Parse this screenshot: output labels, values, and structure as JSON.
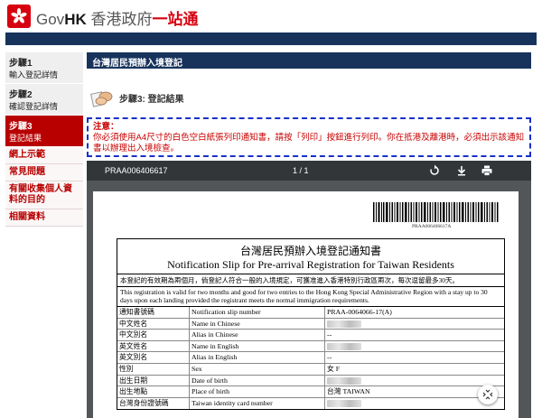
{
  "header": {
    "brand_gov": "Gov",
    "brand_hk": "HK",
    "brand_cn": "香港政府",
    "brand_onestop": "一站通"
  },
  "nav": {
    "steps": [
      {
        "title": "步驟1",
        "subtitle": "輸入登記詳情"
      },
      {
        "title": "步驟2",
        "subtitle": "確認登記詳情"
      },
      {
        "title": "步驟3",
        "subtitle": "登記結果"
      }
    ],
    "links": [
      "網上示範",
      "常見問題",
      "有關收集個人資料的目的",
      "相關資料"
    ]
  },
  "main": {
    "title": "台灣居民預辦入境登記",
    "step_heading": "步驟3: 登記結果"
  },
  "notice": {
    "heading": "注意：",
    "text": "你必須使用A4尺寸的白色空白紙張列印通知書，請按「列印」按鈕進行列印。你在抵港及離港時，必須出示該通知書以辦理出入境檢查。"
  },
  "viewer": {
    "filename": "PRAA006406617",
    "page_indicator": "1 / 1",
    "icons": [
      "rotate-icon",
      "download-icon",
      "print-icon"
    ]
  },
  "slip": {
    "barcode_number": "PRAA006406617A",
    "title_zh": "台灣居民預辦入境登記通知書",
    "title_en": "Notification Slip for Pre-arrival Registration for Taiwan Residents",
    "para_zh": "本登記的有效期為兩個月，倘登記人符合一般的入境規定，可獲准進入香港特別行政區兩次，每次逗留最多30天。",
    "para_en": "This registration is valid for two months and good for two entries to the Hong Kong Special Administrative Region with a stay up to 30 days upon each landing provided the registrant meets the normal immigration requirements.",
    "rows": [
      {
        "zh": "通知書號碼",
        "en": "Notification slip number",
        "value": "PRAA-0064066-17(A)",
        "redacted": false
      },
      {
        "zh": "中文姓名",
        "en": "Name in Chinese",
        "value": "",
        "redacted": true
      },
      {
        "zh": "中文別名",
        "en": "Alias in Chinese",
        "value": "--",
        "redacted": false
      },
      {
        "zh": "英文姓名",
        "en": "Name in English",
        "value": "",
        "redacted": true
      },
      {
        "zh": "英文別名",
        "en": "Alias in English",
        "value": "--",
        "redacted": false
      },
      {
        "zh": "性別",
        "en": "Sex",
        "value": "女 F",
        "redacted": false
      },
      {
        "zh": "出生日期",
        "en": "Date of birth",
        "value": "",
        "redacted": true
      },
      {
        "zh": "出生地點",
        "en": "Place of birth",
        "value": "台灣 TAIWAN",
        "redacted": false
      },
      {
        "zh": "台灣身份證號碼",
        "en": "Taiwan identity card number",
        "value": "",
        "redacted": true
      }
    ]
  }
}
